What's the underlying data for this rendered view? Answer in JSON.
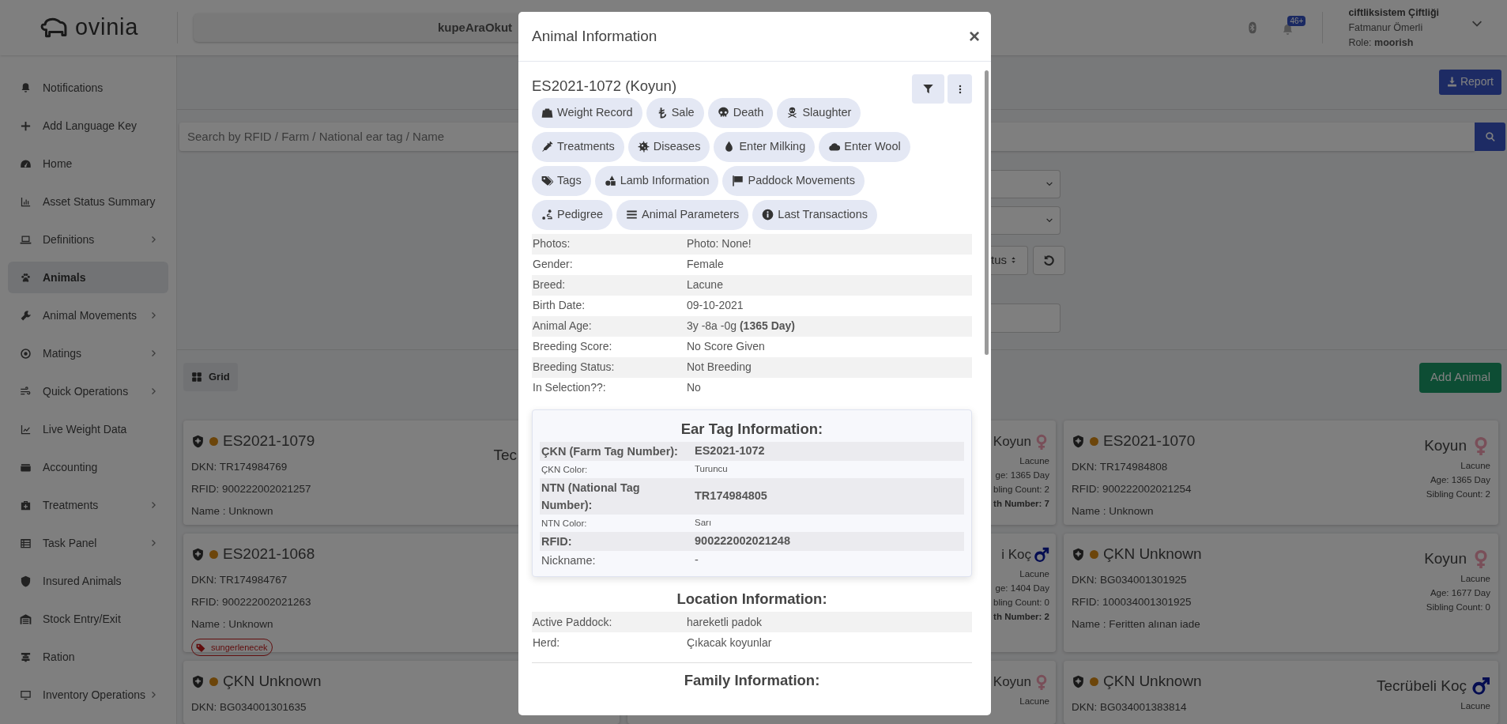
{
  "header": {
    "logo": "ovinia",
    "scan_field": "kupeAraOkut",
    "notification_count": "46+",
    "farm": "ciftliksistem Çiftliği",
    "user": "Fatmanur Ömerli",
    "role": "Role: **moorish**"
  },
  "sidebar": {
    "items": [
      {
        "label": "Notifications",
        "selected": false,
        "expandable": false
      },
      {
        "label": "Add Language Key",
        "selected": false,
        "expandable": false
      },
      {
        "label": "Home",
        "selected": false,
        "expandable": false
      },
      {
        "label": "Asset Status Summary",
        "selected": false,
        "expandable": false
      },
      {
        "label": "Definitions",
        "selected": false,
        "expandable": true
      },
      {
        "label": "Animals",
        "selected": true,
        "expandable": false
      },
      {
        "label": "Animal Movements",
        "selected": false,
        "expandable": true
      },
      {
        "label": "Matings",
        "selected": false,
        "expandable": true
      },
      {
        "label": "Quick Operations",
        "selected": false,
        "expandable": true
      },
      {
        "label": "Live Weight Data",
        "selected": false,
        "expandable": false
      },
      {
        "label": "Accounting",
        "selected": false,
        "expandable": false
      },
      {
        "label": "Treatments",
        "selected": false,
        "expandable": true
      },
      {
        "label": "Task Panel",
        "selected": false,
        "expandable": true
      },
      {
        "label": "Insured Animals",
        "selected": false,
        "expandable": false
      },
      {
        "label": "Stock Entry/Exit",
        "selected": false,
        "expandable": false
      },
      {
        "label": "Ration",
        "selected": false,
        "expandable": false
      },
      {
        "label": "Inventory Operations",
        "selected": false,
        "expandable": true
      }
    ]
  },
  "toolbar": {
    "report": "Report"
  },
  "search": {
    "placeholder": "Search by RFID / Farm / National ear tag / Name"
  },
  "filters": {
    "sort_select": "tus"
  },
  "view_button": "Grid",
  "add_button": "Add Animal",
  "card_rows": [
    {
      "left": {
        "tag": "ES2021-1079",
        "dkn": "DKN: TR174984769",
        "rfid": "RFID: 900222002021257",
        "name": "Name : Unknown",
        "type": "Tec"
      },
      "middle": {
        "type": "Koyun",
        "female": true,
        "breed": "Lacune",
        "age": "ge: 1365 Day",
        "siblings": "bling Count: 2",
        "birth_number": "th Number: 7"
      },
      "right": {
        "tag": "ES2021-1070",
        "dkn": "DKN: TR174984808",
        "rfid": "RFID: 900222002021254",
        "name": "Name : Unknown",
        "type": "Koyun",
        "female": true,
        "breed": "Lacune",
        "age": "Age: 1365 Day",
        "siblings": "Sibling Count: 2"
      }
    },
    {
      "left": {
        "tag": "ES2021-1068",
        "dkn": "DKN: TR174984767",
        "rfid": "RFID: 900222002021263",
        "name": "Name : Unknown",
        "badge": "sungerlenecek"
      },
      "middle": {
        "type": "i Koç",
        "female": false,
        "breed": "Lacune",
        "age": "ge: 1404 Day",
        "siblings": "bling Count: 0",
        "birth_number": "th Number: 2"
      },
      "right": {
        "tag": "ÇKN Unknown",
        "dkn": "DKN: BG034001301925",
        "rfid": "RFID: 100034001301925",
        "name": "Name : Feritten alınan iade",
        "type": "Koyun",
        "female": true,
        "breed": "Lacune",
        "age": "Age: 1677 Day",
        "siblings": "Sibling Count: 0"
      }
    },
    {
      "left": {
        "tag": "ÇKN Unknown",
        "dkn": "DKN: BG034001301635"
      },
      "middle": {
        "type": "Koyun",
        "female": true,
        "breed": "Lacune"
      },
      "right": {
        "tag": "ÇKN Unknown",
        "dkn": "DKN: BG034001383814",
        "type": "Tecrübeli Koç",
        "female": false,
        "breed": "Lacune"
      }
    }
  ],
  "modal": {
    "title": "Animal Information",
    "close": "×",
    "animal": "ES2021-1072 (Koyun)",
    "action_rows": [
      [
        "Weight Record",
        "Sale",
        "Death",
        "Slaughter"
      ],
      [
        "Treatments",
        "Diseases",
        "Enter Milking",
        "Enter Wool"
      ],
      [
        "Tags",
        "Lamb Information",
        "Paddock Movements"
      ],
      [
        "Pedigree",
        "Animal Parameters",
        "Last Transactions"
      ]
    ],
    "details": [
      {
        "label": "Photos:",
        "value": "Photo: None!"
      },
      {
        "label": "Gender:",
        "value": "Female"
      },
      {
        "label": "Breed:",
        "value": "Lacune"
      },
      {
        "label": "Birth Date:",
        "value": "09-10-2021"
      },
      {
        "label": "Animal Age:",
        "value": "3y -8a -0g **(1365 Day)**"
      },
      {
        "label": "Breeding Score:",
        "value": "No Score Given"
      },
      {
        "label": "Breeding Status:",
        "value": "Not Breeding"
      },
      {
        "label": "In Selection??:",
        "value": "No"
      }
    ],
    "ear_tag": {
      "title": "Ear Tag Information:",
      "rows": [
        {
          "label": "ÇKN (Farm Tag Number):",
          "value": "ES2021-1072",
          "kind": "primary"
        },
        {
          "label": "ÇKN Color:",
          "value": "Turuncu",
          "kind": "secondary"
        },
        {
          "label": "NTN (National Tag Number):",
          "value": "TR174984805",
          "kind": "primary"
        },
        {
          "label": "NTN Color:",
          "value": "Sarı",
          "kind": "secondary"
        },
        {
          "label": "RFID:",
          "value": "900222002021248",
          "kind": "primary"
        },
        {
          "label": "Nickname:",
          "value": "-",
          "kind": "plain"
        }
      ]
    },
    "location": {
      "title": "Location Information:",
      "rows": [
        {
          "label": "Active Paddock:",
          "value": "hareketli padok"
        },
        {
          "label": "Herd:",
          "value": "Çıkacak koyunlar"
        }
      ]
    },
    "family": {
      "title": "Family Information:"
    }
  }
}
